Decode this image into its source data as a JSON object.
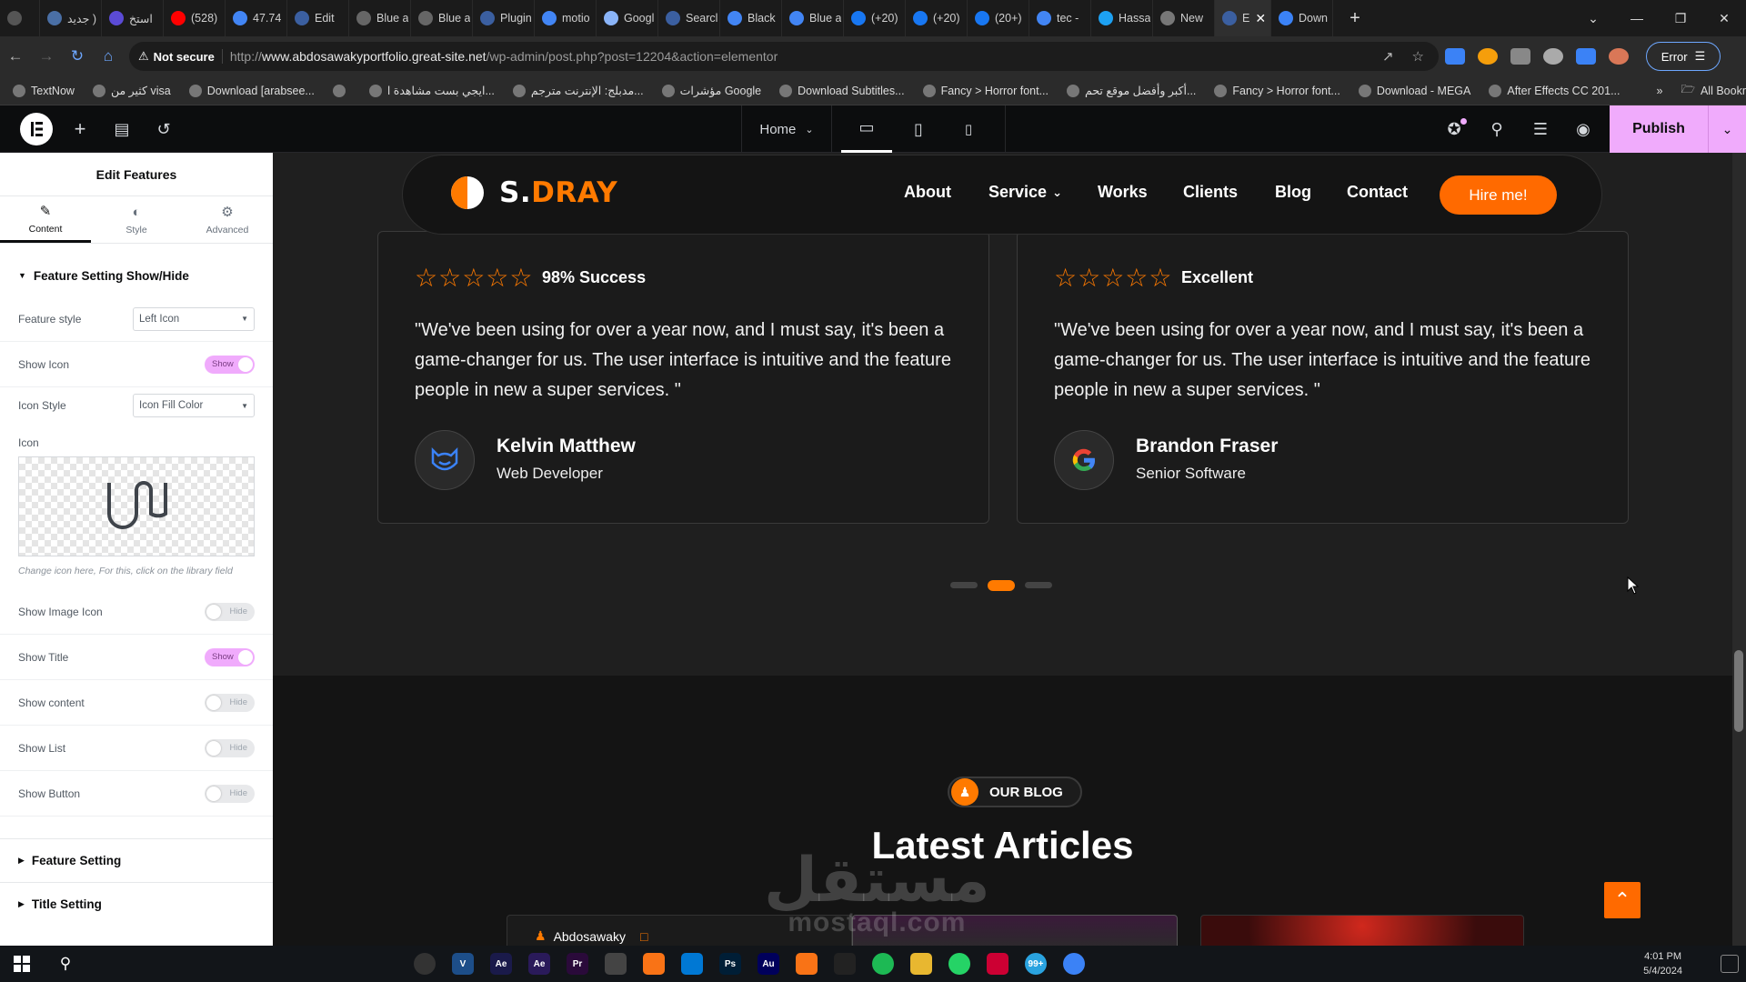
{
  "browser": {
    "tabs": [
      {
        "label": "جديد )",
        "color": "#4a6fa5"
      },
      {
        "label": "استخ",
        "color": "#5b4bd6"
      },
      {
        "label": "(528)",
        "color": "#ff0000"
      },
      {
        "label": "47.74",
        "color": "#4285f4"
      },
      {
        "label": "Edit",
        "color": "#3b5fa0"
      },
      {
        "label": "Blue a",
        "color": "#666666"
      },
      {
        "label": "Blue a",
        "color": "#666666"
      },
      {
        "label": "Plugin",
        "color": "#3b5fa0"
      },
      {
        "label": "motio",
        "color": "#4285f4"
      },
      {
        "label": "Googl",
        "color": "#8ab4f8"
      },
      {
        "label": "Searcl",
        "color": "#3b5fa0"
      },
      {
        "label": "Black",
        "color": "#4285f4"
      },
      {
        "label": "Blue a",
        "color": "#4285f4"
      },
      {
        "label": "(+20)",
        "color": "#1877f2"
      },
      {
        "label": "(+20)",
        "color": "#1877f2"
      },
      {
        "label": "(20+)",
        "color": "#1877f2"
      },
      {
        "label": "tec -",
        "color": "#4285f4"
      },
      {
        "label": "Hassa",
        "color": "#1da1f2"
      },
      {
        "label": "New",
        "color": "#777777"
      },
      {
        "label": "E",
        "color": "#3b5fa0",
        "active": true
      },
      {
        "label": "Down",
        "color": "#3b82f6"
      }
    ],
    "url_prefix": "http://",
    "url_host": "www.abdosawakyportfolio.great-site.net",
    "url_path": "/wp-admin/post.php?post=12204&action=elementor",
    "not_secure": "Not secure",
    "error_label": "Error",
    "bookmarks": [
      "TextNow",
      "كثير من visa",
      "Download [arabsee...",
      "",
      "ايجي بست مشاهدة ا...",
      "مدبلج: الإنترنت مترجم...",
      "مؤشرات Google",
      "Download Subtitles...",
      "Fancy > Horror font...",
      "أكبر وأفضل موقع تحم...",
      "Fancy > Horror font...",
      "Download - MEGA",
      "After Effects CC 201..."
    ],
    "all_bookmarks": "All Bookmarks"
  },
  "editor": {
    "page_select": "Home",
    "publish": "Publish",
    "panel_title": "Edit Features",
    "tabs": [
      "Content",
      "Style",
      "Advanced"
    ],
    "section_title": "Feature Setting Show/Hide",
    "feature_style_label": "Feature style",
    "feature_style_value": "Left Icon",
    "show_icon_label": "Show Icon",
    "icon_style_label": "Icon Style",
    "icon_style_value": "Icon Fill Color",
    "icon_label": "Icon",
    "icon_note": "Change icon here, For this, click on the library field",
    "toggles": [
      {
        "label": "Show Image Icon",
        "state": "Hide"
      },
      {
        "label": "Show Title",
        "state": "Show"
      },
      {
        "label": "Show content",
        "state": "Hide"
      },
      {
        "label": "Show List",
        "state": "Hide"
      },
      {
        "label": "Show Button",
        "state": "Hide"
      }
    ],
    "show_label": "Show",
    "collapsed_sections": [
      "Feature Setting",
      "Title Setting"
    ]
  },
  "site": {
    "logo_part1": "S.",
    "logo_part2": "DRAY",
    "nav": [
      "About",
      "Service",
      "Works",
      "Clients",
      "Blog",
      "Contact"
    ],
    "hire": "Hire me!",
    "accent": "#ff6a00",
    "testimonials": [
      {
        "rating_text": "98% Success",
        "quote": "\"We've been using for over a year now, and I must say, it's been a game-changer for us. The user interface is intuitive and the feature people in new a super services. \"",
        "name": "Kelvin Matthew",
        "role": "Web Developer",
        "icon": "cat-logo-icon"
      },
      {
        "rating_text": "Excellent",
        "quote": "\"We've been using for over a year now, and I must say, it's been a game-changer for us. The user interface is intuitive and the feature people in new a super services. \"",
        "name": "Brandon Fraser",
        "role": "Senior Software",
        "icon": "google-logo-icon"
      }
    ],
    "blog_badge": "OUR BLOG",
    "blog_heading": "Latest Articles",
    "blog_author": "Abdosawaky"
  },
  "watermark": {
    "line1": "مستقل",
    "line2": "mostaql.com"
  },
  "taskbar": {
    "time": "4:01 PM",
    "date": "5/4/2024",
    "badge": "99+"
  }
}
